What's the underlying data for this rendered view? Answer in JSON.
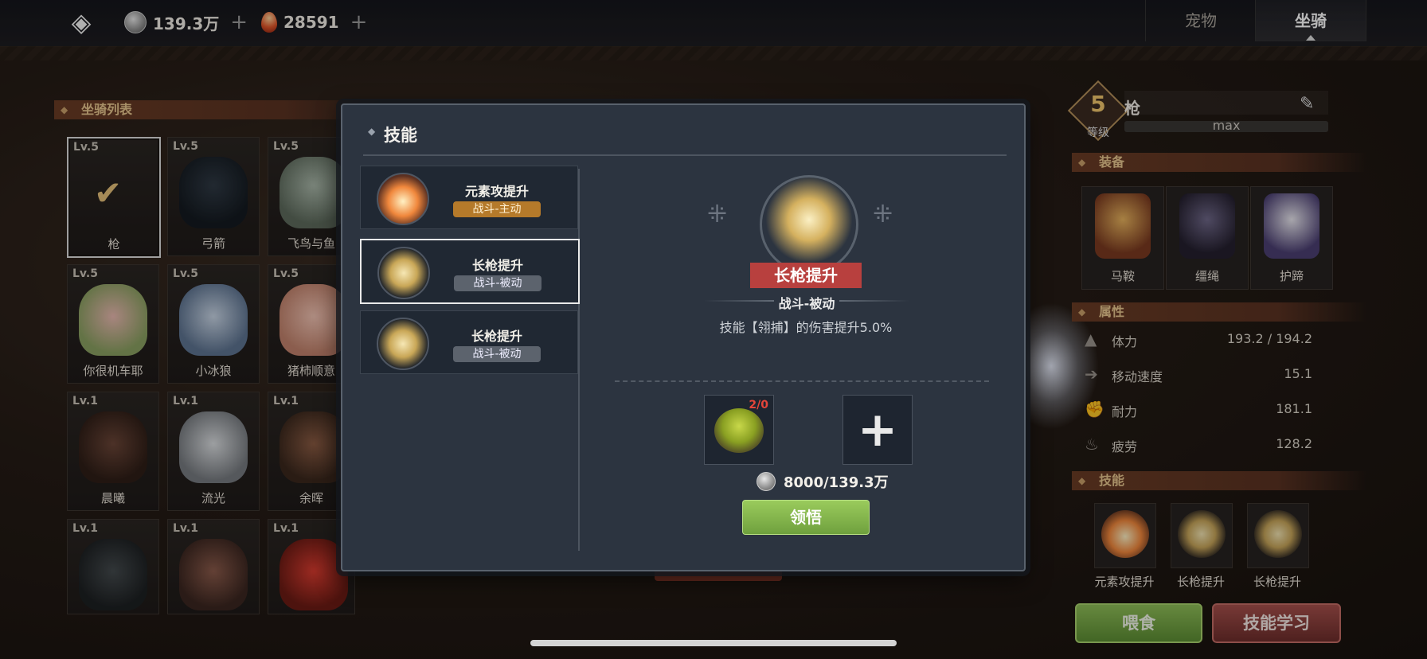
{
  "topbar": {
    "silver": "139.3万",
    "gems": "28591",
    "plus": "+",
    "tabs": [
      "宠物",
      "坐骑"
    ]
  },
  "mount_list": {
    "title": "坐骑列表",
    "items": [
      {
        "level": "Lv.5",
        "name": "枪",
        "selected": true
      },
      {
        "level": "Lv.5",
        "name": "弓箭"
      },
      {
        "level": "Lv.5",
        "name": "飞鸟与鱼"
      },
      {
        "level": "Lv.5",
        "name": "你很机车耶"
      },
      {
        "level": "Lv.5",
        "name": "小冰狼"
      },
      {
        "level": "Lv.5",
        "name": "猪柿顺意"
      },
      {
        "level": "Lv.1",
        "name": "晨曦"
      },
      {
        "level": "Lv.1",
        "name": "流光"
      },
      {
        "level": "Lv.1",
        "name": "余晖"
      },
      {
        "level": "Lv.1",
        "name": ""
      },
      {
        "level": "Lv.1",
        "name": ""
      },
      {
        "level": "Lv.1",
        "name": ""
      }
    ]
  },
  "detail": {
    "level": "5",
    "level_label": "等级",
    "name": "枪",
    "xp_text": "max",
    "equip_title": "装备",
    "equip": [
      "马鞍",
      "缰绳",
      "护蹄"
    ],
    "attr_title": "属性",
    "attrs": [
      {
        "k": "体力",
        "v": "193.2 / 194.2"
      },
      {
        "k": "移动速度",
        "v": "15.1"
      },
      {
        "k": "耐力",
        "v": "181.1"
      },
      {
        "k": "疲劳",
        "v": "128.2"
      }
    ],
    "skills_title": "技能",
    "skills": [
      "元素攻提升",
      "长枪提升",
      "长枪提升"
    ],
    "feed_btn": "喂食",
    "learn_btn": "技能学习"
  },
  "modal": {
    "title": "技能",
    "list": [
      {
        "name": "元素攻提升",
        "tag": "战斗-主动",
        "kind": "active"
      },
      {
        "name": "长枪提升",
        "tag": "战斗-被动",
        "kind": "passive"
      },
      {
        "name": "长枪提升",
        "tag": "战斗-被动",
        "kind": "passive"
      }
    ],
    "selected_name": "长枪提升",
    "selected_type": "战斗-被动",
    "selected_desc": "技能【翎捕】的伤害提升5.0%",
    "material_count": "2/0",
    "cost": "8000/139.3万",
    "comprehend_btn": "领悟"
  }
}
